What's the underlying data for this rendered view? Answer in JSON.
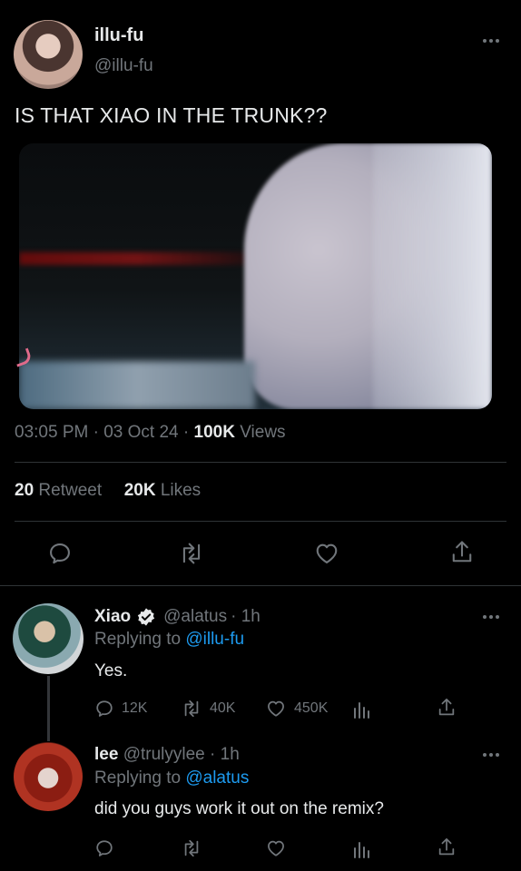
{
  "tweet": {
    "display_name": "illu-fu",
    "handle": "@illu-fu",
    "text": "IS THAT XIAO IN THE TRUNK??",
    "time": "03:05 PM",
    "date": "03 Oct 24",
    "views_count": "100K",
    "views_label": "Views",
    "retweets_count": "20",
    "retweets_label": "Retweet",
    "likes_count": "20K",
    "likes_label": "Likes"
  },
  "replies": [
    {
      "display_name": "Xiao",
      "handle": "@alatus",
      "age": "· 1h",
      "replying_prefix": "Replying to",
      "replying_to": "@illu-fu",
      "text": "Yes.",
      "reply_count": "12K",
      "retweet_count": "40K",
      "like_count": "450K",
      "verified": true
    },
    {
      "display_name": "lee",
      "handle": "@trulyylee",
      "age": "· 1h",
      "replying_prefix": "Replying to",
      "replying_to": "@alatus",
      "text": "did you guys work it out on the remix?"
    }
  ],
  "colors": {
    "background": "#000000",
    "text": "#e7e9ea",
    "secondary": "#71767b",
    "link": "#1d9bf0",
    "divider": "#2f3336"
  },
  "icons": [
    "more-icon",
    "reply-icon",
    "retweet-icon",
    "like-icon",
    "share-icon",
    "analytics-icon",
    "verified-icon"
  ]
}
